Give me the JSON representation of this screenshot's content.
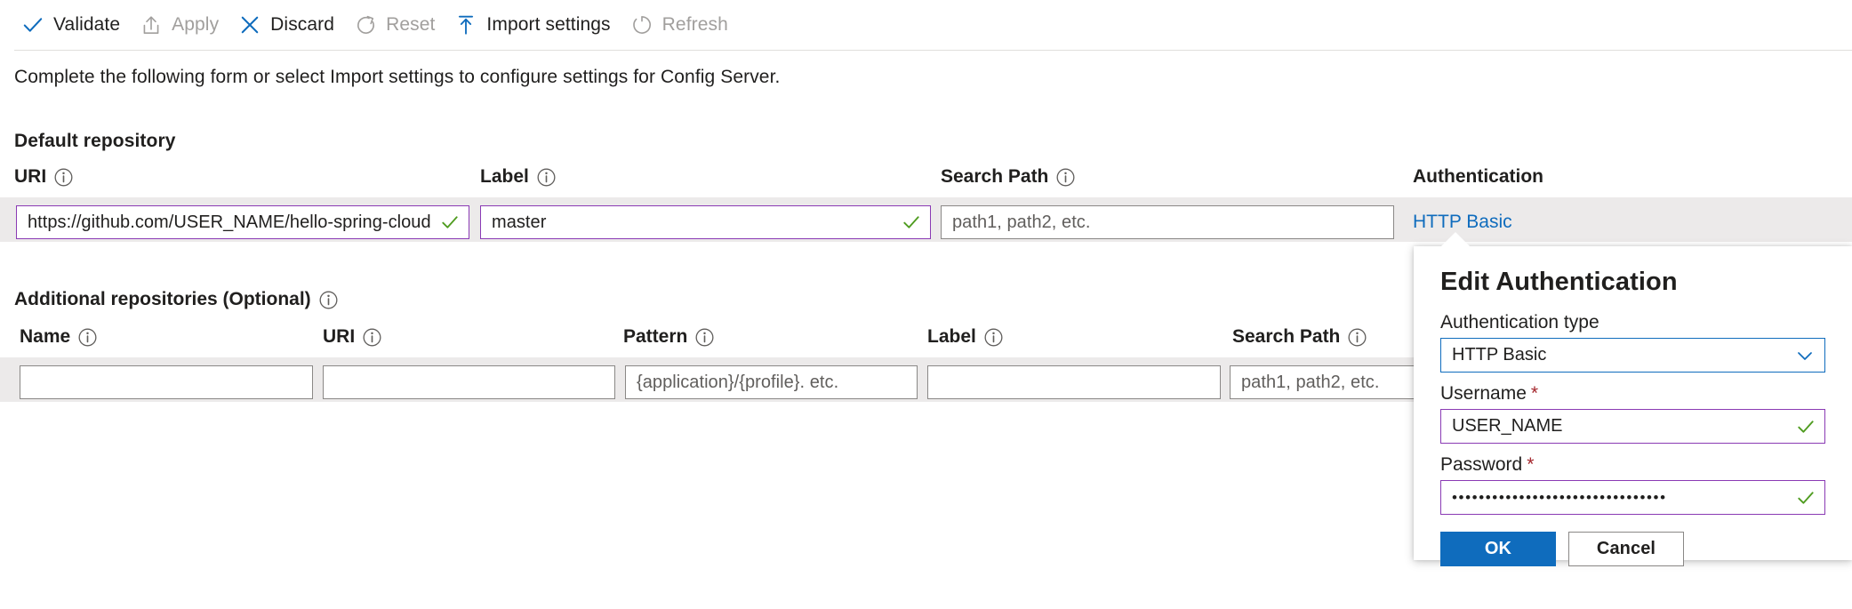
{
  "toolbar": {
    "items": [
      {
        "label": "Validate",
        "icon": "checkmark-icon",
        "enabled": true
      },
      {
        "label": "Apply",
        "icon": "upload-icon",
        "enabled": false
      },
      {
        "label": "Discard",
        "icon": "close-x-icon",
        "enabled": true
      },
      {
        "label": "Reset",
        "icon": "reset-arrow-icon",
        "enabled": false
      },
      {
        "label": "Import settings",
        "icon": "import-up-arrow-icon",
        "enabled": true
      },
      {
        "label": "Refresh",
        "icon": "refresh-circle-icon",
        "enabled": false
      }
    ]
  },
  "intro": {
    "text": "Complete the following form or select Import settings to configure settings for Config Server."
  },
  "default_repository": {
    "section_title": "Default repository",
    "columns": [
      {
        "label": "URI",
        "info": true
      },
      {
        "label": "Label",
        "info": true
      },
      {
        "label": "Search Path",
        "info": true
      },
      {
        "label": "Authentication",
        "info": false
      }
    ],
    "uri": {
      "value": "https://github.com/USER_NAME/hello-spring-cloud",
      "placeholder": "",
      "state": "valid"
    },
    "label_field": {
      "value": "master",
      "placeholder": "",
      "state": "valid"
    },
    "search_path": {
      "value": "",
      "placeholder": "path1, path2, etc.",
      "state": "default"
    },
    "authentication": {
      "link_text": "HTTP Basic"
    }
  },
  "additional_repositories": {
    "section_title": "Additional repositories (Optional)",
    "info": true,
    "columns": [
      {
        "label": "Name",
        "info": true
      },
      {
        "label": "URI",
        "info": true
      },
      {
        "label": "Pattern",
        "info": true
      },
      {
        "label": "Label",
        "info": true
      },
      {
        "label": "Search Path",
        "info": true
      }
    ],
    "row": {
      "name": {
        "value": "",
        "placeholder": ""
      },
      "uri": {
        "value": "",
        "placeholder": ""
      },
      "pattern": {
        "value": "",
        "placeholder": "{application}/{profile}. etc."
      },
      "label_field": {
        "value": "",
        "placeholder": ""
      },
      "search_path": {
        "value": "",
        "placeholder": "path1, path2, etc."
      }
    }
  },
  "callout": {
    "title": "Edit Authentication",
    "auth_type_label": "Authentication type",
    "auth_type_value": "HTTP Basic",
    "username_label": "Username",
    "username_required_mark": "*",
    "username_value": "USER_NAME",
    "password_label": "Password",
    "password_required_mark": "*",
    "password_masked": "••••••••••••••••••••••••••••••••",
    "ok_label": "OK",
    "cancel_label": "Cancel"
  },
  "colors": {
    "accent_blue": "#0f6cbd",
    "link_blue": "#0f6cbd",
    "valid_purple": "#8a3ab4",
    "success_green": "#4f9c20",
    "required_red": "#a4262c",
    "disabled_gray": "#a19f9d",
    "row_band_gray": "#eceaea",
    "border_gray": "#8a8886"
  }
}
